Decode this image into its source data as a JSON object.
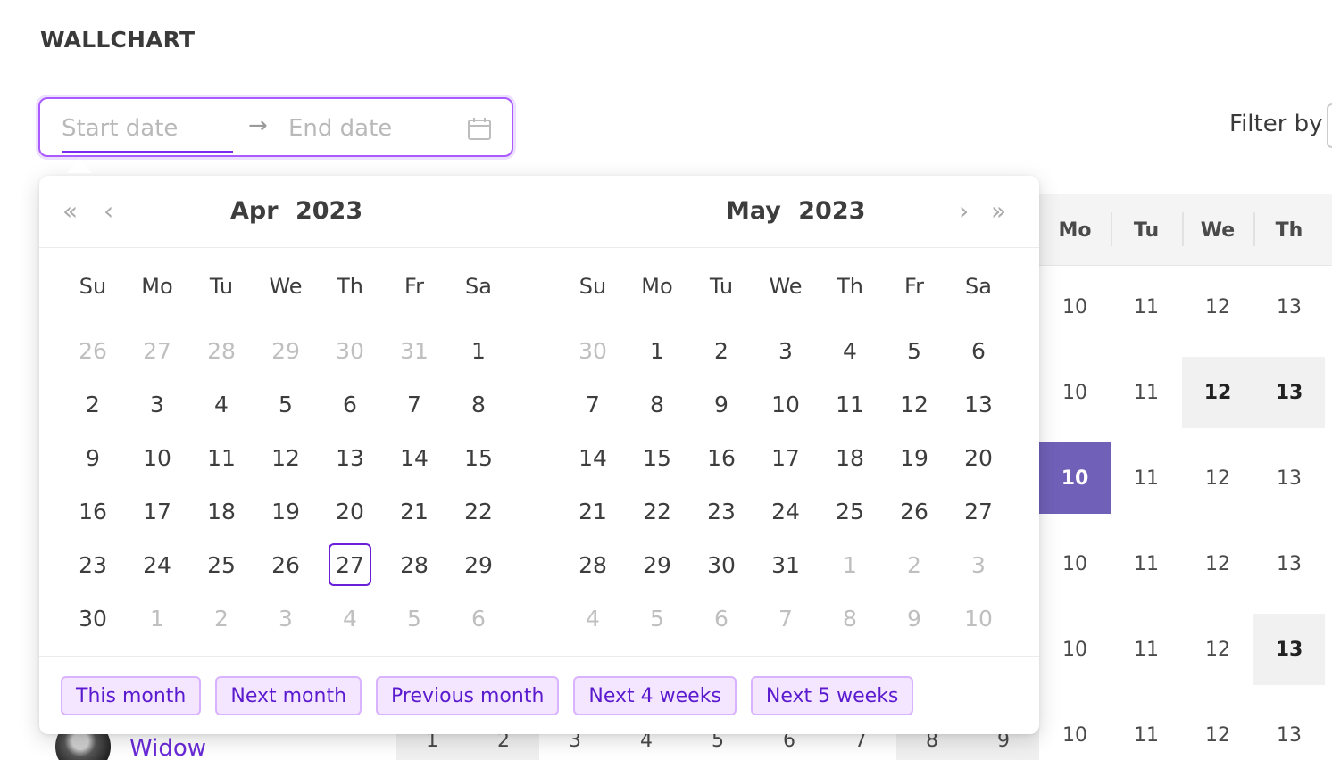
{
  "page": {
    "title": "WALLCHART"
  },
  "range_picker": {
    "start_placeholder": "Start date",
    "end_placeholder": "End date",
    "separator": "→"
  },
  "filter": {
    "label": "Filter by"
  },
  "calendar": {
    "nav": {
      "prev_year": "«",
      "prev_month": "‹",
      "next_month": "›",
      "next_year": "»"
    },
    "left": {
      "month": "Apr",
      "year": "2023",
      "weekdays": [
        "Su",
        "Mo",
        "Tu",
        "We",
        "Th",
        "Fr",
        "Sa"
      ],
      "days": [
        {
          "d": "26",
          "out": true
        },
        {
          "d": "27",
          "out": true
        },
        {
          "d": "28",
          "out": true
        },
        {
          "d": "29",
          "out": true
        },
        {
          "d": "30",
          "out": true
        },
        {
          "d": "31",
          "out": true
        },
        {
          "d": "1"
        },
        {
          "d": "2"
        },
        {
          "d": "3"
        },
        {
          "d": "4"
        },
        {
          "d": "5"
        },
        {
          "d": "6"
        },
        {
          "d": "7"
        },
        {
          "d": "8"
        },
        {
          "d": "9"
        },
        {
          "d": "10"
        },
        {
          "d": "11"
        },
        {
          "d": "12"
        },
        {
          "d": "13"
        },
        {
          "d": "14"
        },
        {
          "d": "15"
        },
        {
          "d": "16"
        },
        {
          "d": "17"
        },
        {
          "d": "18"
        },
        {
          "d": "19"
        },
        {
          "d": "20"
        },
        {
          "d": "21"
        },
        {
          "d": "22"
        },
        {
          "d": "23"
        },
        {
          "d": "24"
        },
        {
          "d": "25"
        },
        {
          "d": "26"
        },
        {
          "d": "27",
          "today": true
        },
        {
          "d": "28"
        },
        {
          "d": "29"
        },
        {
          "d": "30"
        },
        {
          "d": "1",
          "out": true
        },
        {
          "d": "2",
          "out": true
        },
        {
          "d": "3",
          "out": true
        },
        {
          "d": "4",
          "out": true
        },
        {
          "d": "5",
          "out": true
        },
        {
          "d": "6",
          "out": true
        }
      ]
    },
    "right": {
      "month": "May",
      "year": "2023",
      "weekdays": [
        "Su",
        "Mo",
        "Tu",
        "We",
        "Th",
        "Fr",
        "Sa"
      ],
      "days": [
        {
          "d": "30",
          "out": true
        },
        {
          "d": "1"
        },
        {
          "d": "2"
        },
        {
          "d": "3"
        },
        {
          "d": "4"
        },
        {
          "d": "5"
        },
        {
          "d": "6"
        },
        {
          "d": "7"
        },
        {
          "d": "8"
        },
        {
          "d": "9"
        },
        {
          "d": "10"
        },
        {
          "d": "11"
        },
        {
          "d": "12"
        },
        {
          "d": "13"
        },
        {
          "d": "14"
        },
        {
          "d": "15"
        },
        {
          "d": "16"
        },
        {
          "d": "17"
        },
        {
          "d": "18"
        },
        {
          "d": "19"
        },
        {
          "d": "20"
        },
        {
          "d": "21"
        },
        {
          "d": "22"
        },
        {
          "d": "23"
        },
        {
          "d": "24"
        },
        {
          "d": "25"
        },
        {
          "d": "26"
        },
        {
          "d": "27"
        },
        {
          "d": "28"
        },
        {
          "d": "29"
        },
        {
          "d": "30"
        },
        {
          "d": "31"
        },
        {
          "d": "1",
          "out": true
        },
        {
          "d": "2",
          "out": true
        },
        {
          "d": "3",
          "out": true
        },
        {
          "d": "4",
          "out": true
        },
        {
          "d": "5",
          "out": true
        },
        {
          "d": "6",
          "out": true
        },
        {
          "d": "7",
          "out": true
        },
        {
          "d": "8",
          "out": true
        },
        {
          "d": "9",
          "out": true
        },
        {
          "d": "10",
          "out": true
        }
      ]
    },
    "presets": [
      "This month",
      "Next month",
      "Previous month",
      "Next 4 weeks",
      "Next 5 weeks"
    ]
  },
  "wallchart": {
    "header_days": [
      "Mo",
      "Tu",
      "We",
      "Th"
    ],
    "rows": [
      {
        "cells": [
          {
            "v": "10"
          },
          {
            "v": "11"
          },
          {
            "v": "12"
          },
          {
            "v": "13"
          }
        ]
      },
      {
        "cells": [
          {
            "v": "10"
          },
          {
            "v": "11"
          },
          {
            "v": "12",
            "hl": "grey"
          },
          {
            "v": "13",
            "hl": "grey"
          }
        ]
      },
      {
        "cells": [
          {
            "v": "10",
            "hl": "purple"
          },
          {
            "v": "11"
          },
          {
            "v": "12"
          },
          {
            "v": "13"
          }
        ]
      },
      {
        "cells": [
          {
            "v": "10"
          },
          {
            "v": "11"
          },
          {
            "v": "12"
          },
          {
            "v": "13"
          }
        ]
      },
      {
        "cells": [
          {
            "v": "10"
          },
          {
            "v": "11"
          },
          {
            "v": "12"
          },
          {
            "v": "13",
            "hl": "grey"
          }
        ]
      },
      {
        "cells": [
          {
            "v": "10"
          },
          {
            "v": "11"
          },
          {
            "v": "12"
          },
          {
            "v": "13"
          }
        ]
      }
    ],
    "bottom_row": [
      {
        "v": "1",
        "hl": "grey"
      },
      {
        "v": "2",
        "hl": "grey"
      },
      {
        "v": "3"
      },
      {
        "v": "4"
      },
      {
        "v": "5"
      },
      {
        "v": "6"
      },
      {
        "v": "7"
      },
      {
        "v": "8",
        "hl": "grey"
      },
      {
        "v": "9",
        "hl": "grey"
      }
    ],
    "user": {
      "name": "Widow"
    }
  },
  "colors": {
    "accent": "#7a2cf0",
    "highlight_purple": "#7160b8",
    "preset_bg": "#f5e6ff"
  }
}
